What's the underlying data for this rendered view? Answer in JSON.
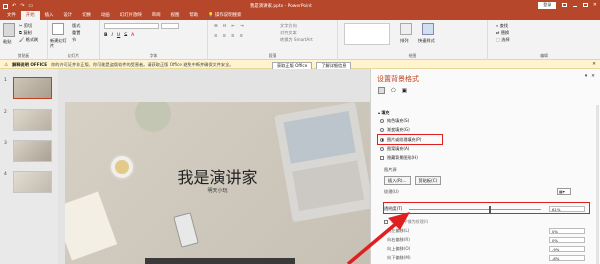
{
  "window": {
    "title": "我是演讲家.pptx - PowerPoint",
    "signin": "登录"
  },
  "tabs": [
    "文件",
    "开始",
    "插入",
    "设计",
    "切换",
    "动画",
    "幻灯片放映",
    "审阅",
    "视图",
    "帮助",
    "操作说明搜索"
  ],
  "ribbon": {
    "paste": "粘贴",
    "cut": "剪切",
    "copy": "复制",
    "format_painter": "格式刷",
    "new_slide": "新建幻灯片",
    "layout": "版式",
    "reset": "重置",
    "section": "节",
    "clipboard": "剪贴板",
    "slides": "幻灯片",
    "font": "字体",
    "paragraph": "段落",
    "drawing": "绘图",
    "editing": "编辑",
    "text_direction": "文字方向",
    "align_text": "对齐文本",
    "convert_smartart": "转换为 SmartArt",
    "shapes": "形状",
    "arrange": "排列",
    "quick_styles": "快速样式",
    "find": "查找",
    "replace": "替换",
    "select": "选择"
  },
  "message": {
    "label": "解释说明 OFFICE",
    "text": "你的许可证并非正版，你可能是盗版软件的受害者。请获取正版 Office 避免中断并确保文件安全。",
    "button1": "获取正版 Office",
    "button2": "了解详细信息"
  },
  "thumbnails": [
    "1",
    "2",
    "3",
    "4"
  ],
  "slide": {
    "title": "我是演讲家",
    "subtitle": "明天小玩"
  },
  "pane": {
    "title": "设置背景格式",
    "section": "▴ 填充",
    "fill_options": [
      "纯色填充(S)",
      "渐变填充(G)",
      "图片或纹理填充(P)",
      "图案填充(A)",
      "隐藏背景图形(H)"
    ],
    "selected_fill": 2,
    "picture_source": "图片源",
    "insert_button": "插入(R)...",
    "clipboard_button": "剪贴板(C)",
    "texture_label": "纹理(U)",
    "transparency_label": "透明度(T)",
    "transparency_value": "61%",
    "transparency_fraction": 0.61,
    "tile_checkbox": "将图片平铺为纹理(I)",
    "offsets": [
      {
        "label": "向左偏移(L)",
        "value": "0%"
      },
      {
        "label": "向右偏移(R)",
        "value": "0%"
      },
      {
        "label": "向上偏移(O)",
        "value": "-9%"
      },
      {
        "label": "向下偏移(M)",
        "value": "-8%"
      }
    ]
  },
  "colors": {
    "accent": "#b7472a",
    "highlight": "#e02020"
  }
}
